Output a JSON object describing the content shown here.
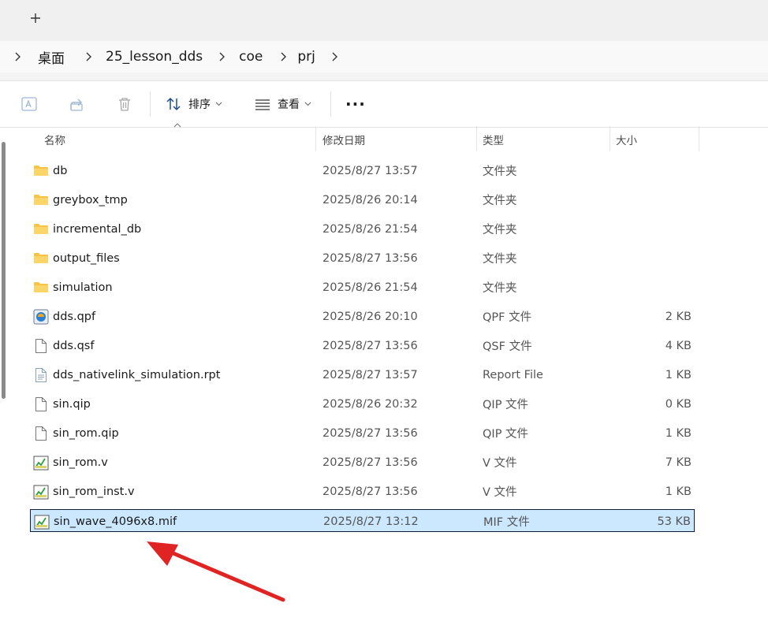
{
  "tabs": {
    "new_tab_icon": "plus-icon"
  },
  "breadcrumb": {
    "items": [
      "桌面",
      "25_lesson_dds",
      "coe",
      "prj"
    ]
  },
  "toolbar": {
    "sort_label": "排序",
    "view_label": "查看",
    "more_label": "···"
  },
  "columns": {
    "name": "名称",
    "date": "修改日期",
    "type": "类型",
    "size": "大小"
  },
  "files": [
    {
      "name": "db",
      "date": "2025/8/27 13:57",
      "type": "文件夹",
      "size": "",
      "icon": "folder-icon"
    },
    {
      "name": "greybox_tmp",
      "date": "2025/8/26 20:14",
      "type": "文件夹",
      "size": "",
      "icon": "folder-icon"
    },
    {
      "name": "incremental_db",
      "date": "2025/8/26 21:54",
      "type": "文件夹",
      "size": "",
      "icon": "folder-icon"
    },
    {
      "name": "output_files",
      "date": "2025/8/27 13:56",
      "type": "文件夹",
      "size": "",
      "icon": "folder-icon"
    },
    {
      "name": "simulation",
      "date": "2025/8/26 21:54",
      "type": "文件夹",
      "size": "",
      "icon": "folder-icon"
    },
    {
      "name": "dds.qpf",
      "date": "2025/8/26 20:10",
      "type": "QPF 文件",
      "size": "2 KB",
      "icon": "quartus-project-icon"
    },
    {
      "name": "dds.qsf",
      "date": "2025/8/27 13:56",
      "type": "QSF 文件",
      "size": "4 KB",
      "icon": "file-icon"
    },
    {
      "name": "dds_nativelink_simulation.rpt",
      "date": "2025/8/27 13:57",
      "type": "Report File",
      "size": "1 KB",
      "icon": "text-file-icon"
    },
    {
      "name": "sin.qip",
      "date": "2025/8/26 20:32",
      "type": "QIP 文件",
      "size": "0 KB",
      "icon": "file-icon"
    },
    {
      "name": "sin_rom.qip",
      "date": "2025/8/27 13:56",
      "type": "QIP 文件",
      "size": "1 KB",
      "icon": "file-icon"
    },
    {
      "name": "sin_rom.v",
      "date": "2025/8/27 13:56",
      "type": "V 文件",
      "size": "7 KB",
      "icon": "verilog-file-icon"
    },
    {
      "name": "sin_rom_inst.v",
      "date": "2025/8/27 13:56",
      "type": "V 文件",
      "size": "1 KB",
      "icon": "verilog-file-icon"
    },
    {
      "name": "sin_wave_4096x8.mif",
      "date": "2025/8/27 13:12",
      "type": "MIF 文件",
      "size": "53 KB",
      "icon": "mif-file-icon"
    }
  ],
  "selected_file": "sin_wave_4096x8.mif",
  "colors": {
    "selection_bg": "#cce8ff",
    "selection_border": "#0f1f3a",
    "folder": "#f8c447",
    "annotation_arrow": "#e02424"
  }
}
